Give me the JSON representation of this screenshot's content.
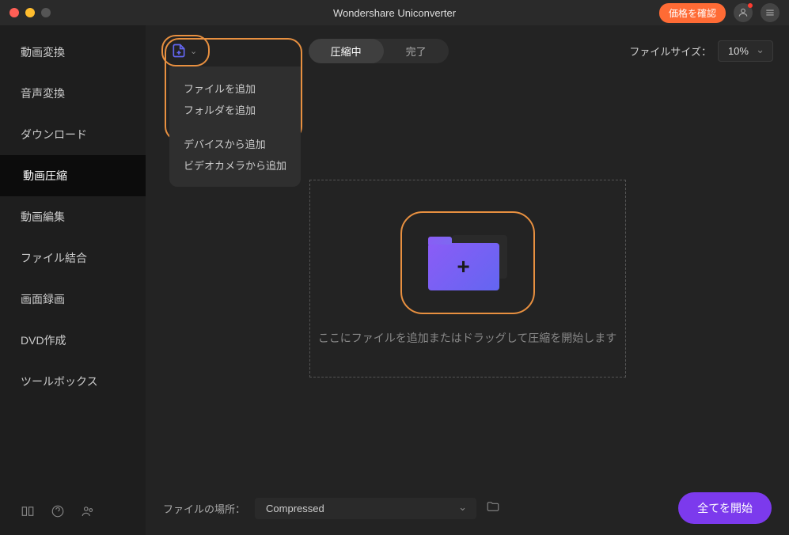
{
  "titlebar": {
    "title": "Wondershare Uniconverter",
    "price_button": "価格を確認"
  },
  "sidebar": {
    "items": [
      {
        "label": "動画変換"
      },
      {
        "label": "音声変換"
      },
      {
        "label": "ダウンロード"
      },
      {
        "label": "動画圧縮"
      },
      {
        "label": "動画編集"
      },
      {
        "label": "ファイル結合"
      },
      {
        "label": "画面録画"
      },
      {
        "label": "DVD作成"
      },
      {
        "label": "ツールボックス"
      }
    ],
    "active_index": 3
  },
  "add_menu": {
    "items_a": [
      "ファイルを追加",
      "フォルダを追加"
    ],
    "items_b": [
      "デバイスから追加",
      "ビデオカメラから追加"
    ]
  },
  "tabs": {
    "compressing": "圧縮中",
    "done": "完了",
    "active": "compressing"
  },
  "filesize": {
    "label": "ファイルサイズ：",
    "value": "10%"
  },
  "dropzone": {
    "text": "ここにファイルを追加またはドラッグして圧縮を開始します"
  },
  "bottom": {
    "location_label": "ファイルの場所：",
    "location_value": "Compressed",
    "start": "全てを開始"
  }
}
